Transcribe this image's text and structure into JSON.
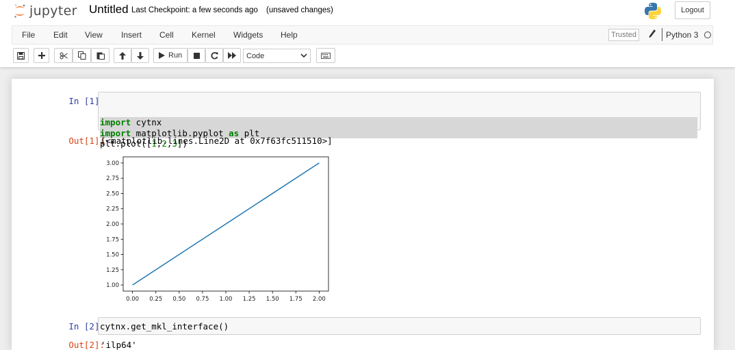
{
  "header": {
    "logo_text": "jupyter",
    "notebook_name": "Untitled",
    "checkpoint": "Last Checkpoint: a few seconds ago",
    "autosave": "(unsaved changes)",
    "logout_label": "Logout"
  },
  "menubar": {
    "items": [
      "File",
      "Edit",
      "View",
      "Insert",
      "Cell",
      "Kernel",
      "Widgets",
      "Help"
    ],
    "trusted_label": "Trusted",
    "kernel_name": "Python 3"
  },
  "toolbar": {
    "run_label": "Run",
    "cell_type": "Code",
    "icons": [
      "save-icon",
      "plus-icon",
      "cut-icon",
      "copy-icon",
      "paste-icon",
      "arrow-up-icon",
      "arrow-down-icon",
      "run-icon",
      "stop-icon",
      "restart-icon",
      "fast-forward-icon",
      "keyboard-icon"
    ]
  },
  "cells": [
    {
      "in_prompt": "In [1]:",
      "code_lines": [
        [
          {
            "t": "import",
            "c": "kw"
          },
          {
            "t": " cytnx",
            "c": ""
          }
        ],
        [
          {
            "t": "import",
            "c": "kw"
          },
          {
            "t": " matplotlib.pyplot ",
            "c": ""
          },
          {
            "t": "as",
            "c": "kw"
          },
          {
            "t": " plt",
            "c": ""
          }
        ],
        [
          {
            "t": "plt.plot([",
            "c": ""
          },
          {
            "t": "1",
            "c": "num"
          },
          {
            "t": ",",
            "c": ""
          },
          {
            "t": "2",
            "c": "num"
          },
          {
            "t": ",",
            "c": ""
          },
          {
            "t": "3",
            "c": "num"
          },
          {
            "t": "])",
            "c": ""
          }
        ]
      ],
      "out_prompt": "Out[1]:",
      "output_text": "[<matplotlib.lines.Line2D at 0x7f63fc511510>]"
    },
    {
      "in_prompt": "In [2]:",
      "code_text": "cytnx.get_mkl_interface()",
      "out_prompt": "Out[2]:",
      "output_text": "'ilp64'"
    }
  ],
  "chart_data": {
    "type": "line",
    "x": [
      0,
      1,
      2
    ],
    "series": [
      {
        "values": [
          1,
          2,
          3
        ]
      }
    ],
    "xlim": [
      -0.1,
      2.1
    ],
    "ylim": [
      0.9,
      3.1
    ],
    "xticks": [
      "0.00",
      "0.25",
      "0.50",
      "0.75",
      "1.00",
      "1.25",
      "1.50",
      "1.75",
      "2.00"
    ],
    "yticks": [
      "1.00",
      "1.25",
      "1.50",
      "1.75",
      "2.00",
      "2.25",
      "2.50",
      "2.75",
      "3.00"
    ],
    "line_color": "#1f77b4",
    "grid": false
  }
}
